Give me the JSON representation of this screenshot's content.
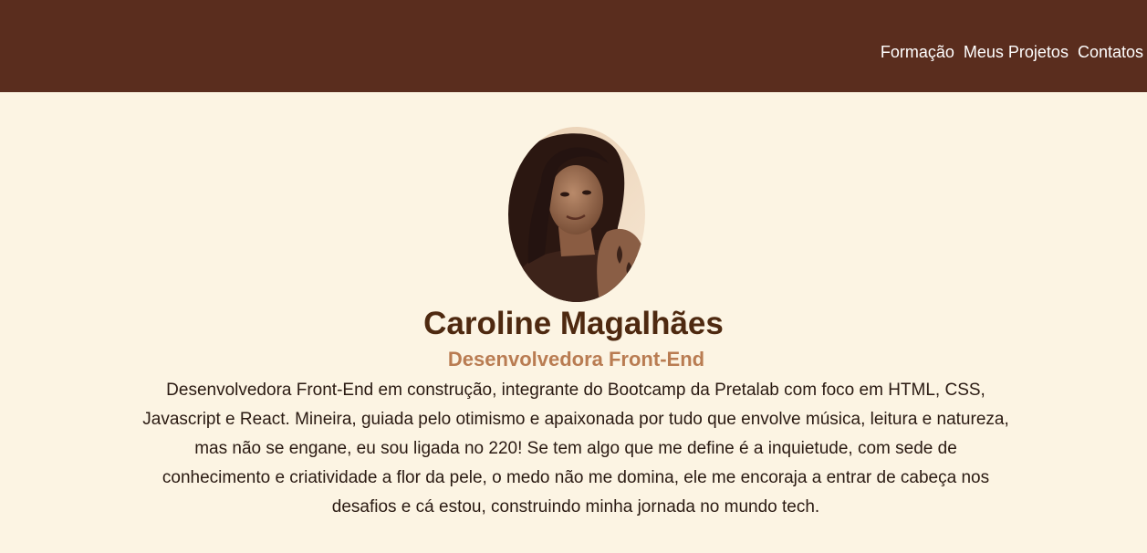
{
  "nav": {
    "items": [
      {
        "label": "Formação"
      },
      {
        "label": "Meus Projetos"
      },
      {
        "label": "Contatos"
      }
    ]
  },
  "profile": {
    "photo_alt": "Foto de Caroline Magalhães",
    "name": "Caroline Magalhães",
    "role": "Desenvolvedora Front-End",
    "bio": "Desenvolvedora Front-End em construção, integrante do Bootcamp da Pretalab com foco em HTML, CSS, Javascript e React. Mineira, guiada pelo otimismo e apaixonada por tudo que envolve música, leitura e natureza, mas não se engane, eu sou ligada no 220! Se tem algo que me define é a inquietude, com sede de conhecimento e criatividade a flor da pele, o medo não me domina, ele me encoraja a entrar de cabeça nos desafios e cá estou, construindo minha jornada no mundo tech."
  },
  "colors": {
    "header_bg": "#5a2d1e",
    "page_bg": "#fcf4e3",
    "name": "#4e2910",
    "role": "#b97c52"
  }
}
